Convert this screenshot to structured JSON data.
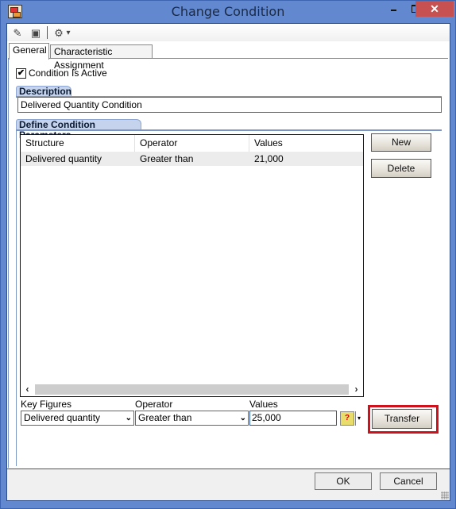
{
  "window": {
    "title": "Change Condition",
    "minimize_glyph": "",
    "maximize_glyph": "",
    "close_glyph": "✕"
  },
  "toolbar": {
    "icons": [
      "edit-pencil-icon",
      "save-disk-icon",
      "tools-wrench-icon",
      "dropdown-arrow-icon"
    ],
    "edit_glyph": "✎",
    "save_glyph": "▣",
    "tools_glyph": "⚙",
    "dropdown_glyph": "▾"
  },
  "tabs": [
    {
      "label": "General",
      "active": true
    },
    {
      "label": "Characteristic Assignment",
      "active": false
    }
  ],
  "general": {
    "condition_active": {
      "label": "Condition Is Active",
      "checked": true,
      "glyph": "✔"
    },
    "description": {
      "group_label": "Description",
      "value": "Delivered Quantity Condition"
    },
    "parameters": {
      "group_label": "Define Condition Parameters",
      "columns": [
        "Structure",
        "Operator",
        "Values"
      ],
      "rows": [
        {
          "structure": "Delivered quantity",
          "operator": "Greater than",
          "values": "21,000"
        }
      ],
      "scroll_left_glyph": "‹",
      "scroll_right_glyph": "›",
      "new_label": "New",
      "delete_label": "Delete"
    },
    "editor": {
      "key_figures_label": "Key Figures",
      "key_figures_value": "Delivered quantity",
      "operator_label": "Operator",
      "operator_value": "Greater than",
      "values_label": "Values",
      "values_value": "25,000",
      "dropdown_glyph": "⌄",
      "value_help_glyph": "?",
      "value_help_drop_glyph": "▾",
      "transfer_label": "Transfer",
      "highlight_color": "#d0111b"
    }
  },
  "footer": {
    "ok_label": "OK",
    "cancel_label": "Cancel"
  }
}
